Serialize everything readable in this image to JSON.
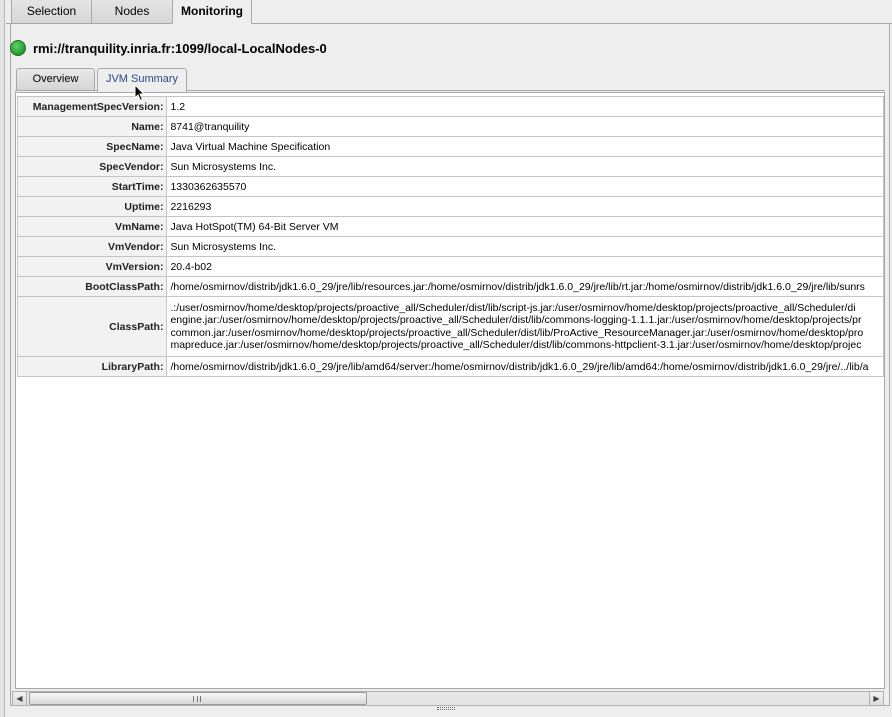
{
  "top_tabs": [
    "Selection",
    "Nodes",
    "Monitoring"
  ],
  "node": {
    "url": "rmi://tranquility.inria.fr:1099/local-LocalNodes-0",
    "status_color": "#1e9a2a"
  },
  "inner_tabs": [
    "Overview",
    "JVM Summary"
  ],
  "properties": [
    {
      "key": "ManagementSpecVersion:",
      "value": "1.2"
    },
    {
      "key": "Name:",
      "value": "8741@tranquility"
    },
    {
      "key": "SpecName:",
      "value": "Java Virtual Machine Specification"
    },
    {
      "key": "SpecVendor:",
      "value": "Sun Microsystems Inc."
    },
    {
      "key": "StartTime:",
      "value": "1330362635570"
    },
    {
      "key": "Uptime:",
      "value": "2216293"
    },
    {
      "key": "VmName:",
      "value": "Java HotSpot(TM) 64-Bit Server VM"
    },
    {
      "key": "VmVendor:",
      "value": "Sun Microsystems Inc."
    },
    {
      "key": "VmVersion:",
      "value": "20.4-b02"
    },
    {
      "key": "BootClassPath:",
      "value": "/home/osmirnov/distrib/jdk1.6.0_29/jre/lib/resources.jar:/home/osmirnov/distrib/jdk1.6.0_29/jre/lib/rt.jar:/home/osmirnov/distrib/jdk1.6.0_29/jre/lib/sunrs"
    },
    {
      "key": "ClassPath:",
      "value": ".:/user/osmirnov/home/desktop/projects/proactive_all/Scheduler/dist/lib/script-js.jar:/user/osmirnov/home/desktop/projects/proactive_all/Scheduler/di\nengine.jar:/user/osmirnov/home/desktop/projects/proactive_all/Scheduler/dist/lib/commons-logging-1.1.1.jar:/user/osmirnov/home/desktop/projects/pr\ncommon.jar:/user/osmirnov/home/desktop/projects/proactive_all/Scheduler/dist/lib/ProActive_ResourceManager.jar:/user/osmirnov/home/desktop/pro\nmapreduce.jar:/user/osmirnov/home/desktop/projects/proactive_all/Scheduler/dist/lib/commons-httpclient-3.1.jar:/user/osmirnov/home/desktop/projec",
      "multi": true
    },
    {
      "key": "LibraryPath:",
      "value": "/home/osmirnov/distrib/jdk1.6.0_29/jre/lib/amd64/server:/home/osmirnov/distrib/jdk1.6.0_29/jre/lib/amd64:/home/osmirnov/distrib/jdk1.6.0_29/jre/../lib/a"
    }
  ]
}
